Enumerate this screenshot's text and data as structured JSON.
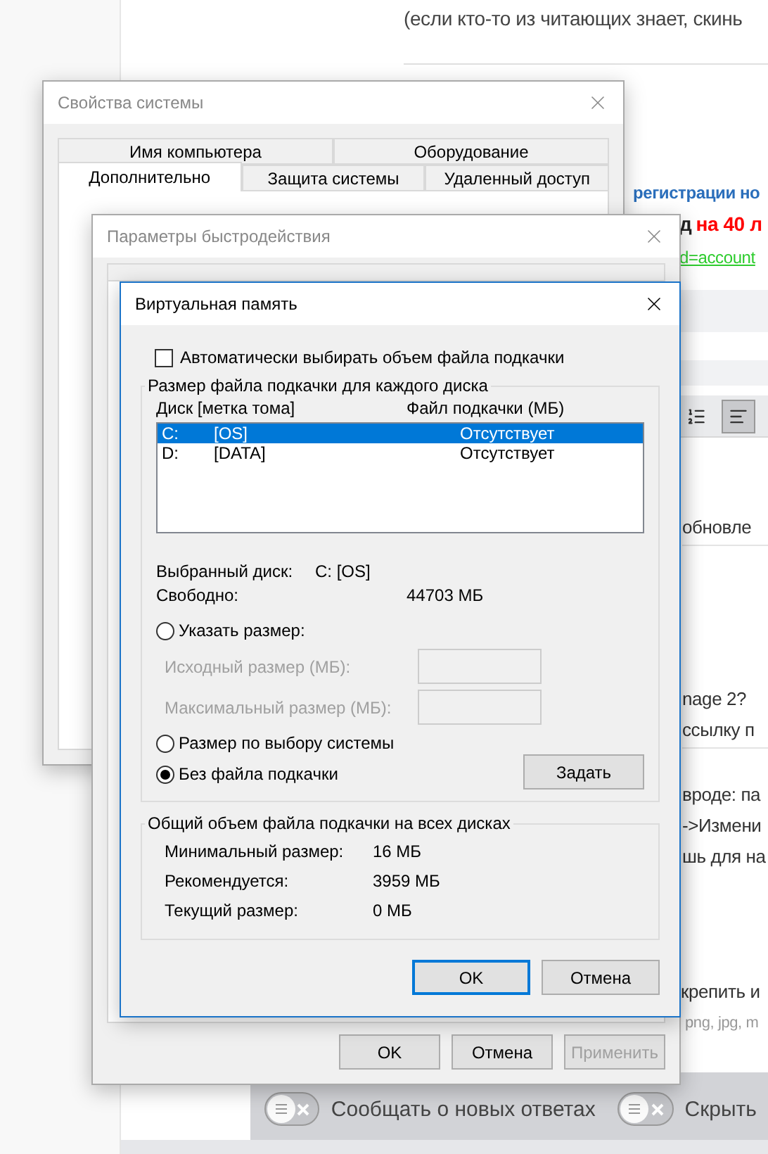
{
  "background_page": {
    "intro": "(если кто-то из читающих знает, скинь",
    "heading_fragment": "регистрации но",
    "promo": {
      "bold": "д",
      "highlight": "на 40 л"
    },
    "link_fragment": "d=account",
    "editor_toolbar": [
      {
        "kind": "numbered-list",
        "selected": false
      },
      {
        "kind": "align-left",
        "selected": true
      }
    ],
    "fragments": [
      {
        "text": "обновле",
        "kind": "row"
      },
      {
        "text": "nage 2?",
        "kind": "title"
      },
      {
        "text": "ссылку п",
        "kind": "row"
      },
      {
        "text": "вроде: па",
        "kind": "line"
      },
      {
        "text": "->Измени",
        "kind": "line"
      },
      {
        "text": "шь для на",
        "kind": "line"
      }
    ],
    "attach_fragment": "крепить и",
    "formats_fragment": "png, jpg, m"
  },
  "system_properties": {
    "title": "Свойства системы",
    "tab_rows": [
      {
        "tabs": [
          {
            "label": "Имя компьютера",
            "selected": false
          },
          {
            "label": "Оборудование",
            "selected": false
          }
        ]
      },
      {
        "tabs": [
          {
            "label": "Дополнительно",
            "selected": true
          },
          {
            "label": "Защита системы",
            "selected": false
          },
          {
            "label": "Удаленный доступ",
            "selected": false
          }
        ]
      }
    ]
  },
  "performance_options": {
    "title": "Параметры быстродействия",
    "buttons": [
      {
        "label": "OK",
        "disabled": false
      },
      {
        "label": "Отмена",
        "disabled": false
      },
      {
        "label": "Применить",
        "disabled": true
      }
    ]
  },
  "virtual_memory": {
    "title": "Виртуальная память",
    "auto_checkbox": {
      "label": "Автоматически выбирать объем файла подкачки",
      "checked": false
    },
    "per_drive_group": {
      "title": "Размер файла подкачки для каждого диска",
      "columns": [
        "Диск [метка тома]",
        "Файл подкачки (МБ)"
      ],
      "drives": [
        {
          "letter": "C:",
          "label": "[OS]",
          "paging_file": "Отсутствует",
          "selected": true
        },
        {
          "letter": "D:",
          "label": "[DATA]",
          "paging_file": "Отсутствует",
          "selected": false
        }
      ],
      "selected_drive": {
        "label": "Выбранный диск:",
        "value": "C:  [OS]"
      },
      "free_space": {
        "label": "Свободно:",
        "value": "44703 МБ"
      },
      "options": [
        {
          "kind": "custom",
          "label": "Указать размер:",
          "selected": false
        },
        {
          "kind": "system",
          "label": "Размер по выбору системы",
          "selected": false
        },
        {
          "kind": "none",
          "label": "Без файла подкачки",
          "selected": true
        }
      ],
      "size_fields": [
        {
          "label": "Исходный размер (МБ):",
          "disabled": true
        },
        {
          "label": "Максимальный размер (МБ):",
          "disabled": true
        }
      ],
      "set_button": "Задать"
    },
    "total_group": {
      "title": "Общий объем файла подкачки на всех дисках",
      "rows": [
        {
          "label": "Минимальный размер:",
          "value": "16 МБ"
        },
        {
          "label": "Рекомендуется:",
          "value": "3959 МБ"
        },
        {
          "label": "Текущий размер:",
          "value": "0 МБ"
        }
      ]
    },
    "buttons": [
      {
        "label": "OK",
        "default": true
      },
      {
        "label": "Отмена",
        "default": false
      }
    ]
  },
  "bottom_bar": {
    "toggles": [
      {
        "label": "Сообщать о новых ответах",
        "on": false
      },
      {
        "label": "Скрыть",
        "on": false
      }
    ]
  }
}
